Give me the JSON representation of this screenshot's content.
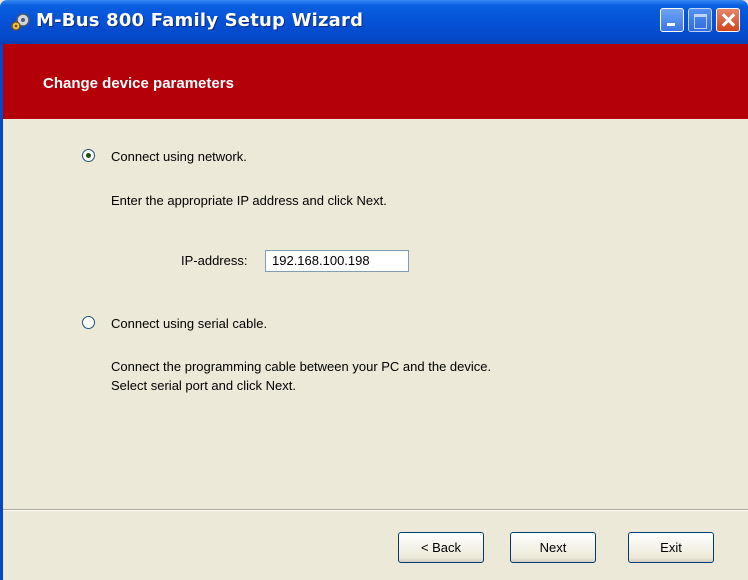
{
  "window": {
    "title": "M-Bus 800 Family Setup Wizard"
  },
  "banner": {
    "title": "Change device parameters"
  },
  "options": {
    "network": {
      "label": "Connect using network.",
      "selected": true,
      "description": "Enter the appropriate IP address and click Next.",
      "ip_label": "IP-address:",
      "ip_value": "192.168.100.198"
    },
    "serial": {
      "label": "Connect using serial cable.",
      "selected": false,
      "description_line1": "Connect the programming cable between your PC and the device.",
      "description_line2": "Select serial port and click Next."
    }
  },
  "buttons": {
    "back": "< Back",
    "next": "Next",
    "exit": "Exit"
  },
  "colors": {
    "banner": "#b30009",
    "titlebar": "#0551d6",
    "background": "#ECE9D8"
  },
  "icons": {
    "app": "wizard-gear-icon",
    "minimize": "minimize-icon",
    "maximize": "maximize-icon",
    "close": "close-icon"
  }
}
